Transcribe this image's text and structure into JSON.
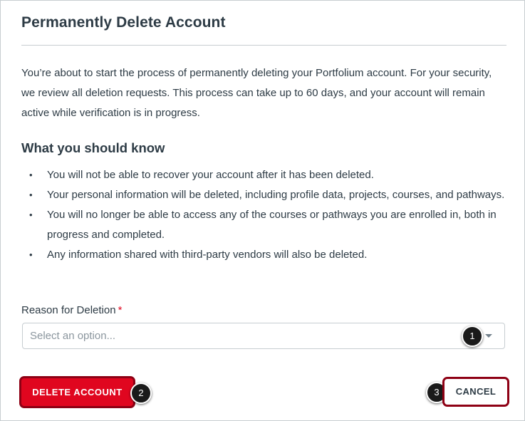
{
  "dialog": {
    "title": "Permanently Delete Account",
    "intro": "You’re about to start the process of permanently deleting your Portfolium account. For your security, we review all deletion requests. This process can take up to 60 days, and your account will remain active while verification is in progress.",
    "subheading": "What you should know",
    "bullets": [
      "You will not be able to recover your account after it has been deleted.",
      "Your personal information will be deleted, including profile data, projects, courses, and pathways.",
      "You will no longer be able to access any of the courses or pathways you are enrolled in, both in progress and completed.",
      "Any information shared with third-party vendors will also be deleted."
    ],
    "bullet_symbol": "•",
    "reason_label": "Reason for Deletion",
    "required_marker": "*",
    "reason_select": {
      "placeholder": "Select an option...",
      "icon": "caret-down-icon"
    },
    "delete_button": "DELETE ACCOUNT",
    "cancel_button": "CANCEL"
  },
  "callouts": [
    "1",
    "2",
    "3"
  ],
  "colors": {
    "danger": "#e0061f",
    "highlight_border": "#8e0014",
    "text": "#2d3b45",
    "border": "#c7cdd1",
    "placeholder": "#8b969e"
  }
}
